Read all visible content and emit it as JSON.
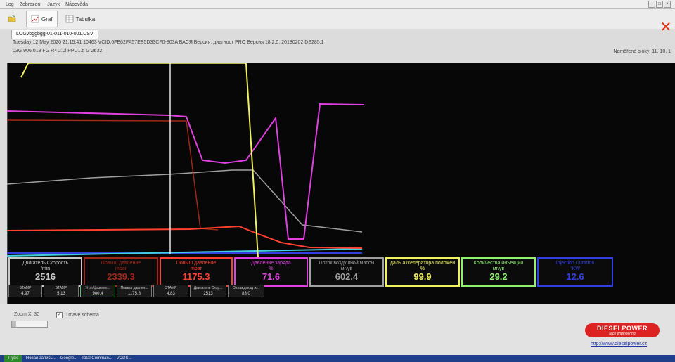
{
  "menu": {
    "items": [
      "Log",
      "Zobrazení",
      "Jazyk",
      "Nápověda"
    ]
  },
  "toolbar": {
    "graf_label": "Graf",
    "tabulka_label": "Tabulka"
  },
  "file_tab": {
    "name": "LOGvbggbgg-01-011-010-001.CSV"
  },
  "info": {
    "line1": "Tuesday 12 May 2020 21:15:41 10463 VCID:6FE62FA57EB5D33CF0-803A ВАСЯ Версия: диагност PRO Версия 18.2.0: 20180202 DS285.1",
    "line2": "03G 906 018 FG  R4 2.0l PPD1.5 G    2632",
    "blocks": "Naměřené bloky: 11, 10, 1"
  },
  "colors": {
    "pink": "#e040e0",
    "darkred": "#a02818",
    "gray": "#a0a0a0",
    "red": "#ff4030",
    "yellow": "#f0f060",
    "white": "#e8e8e8",
    "cyan": "#40d0e0",
    "blue": "#3040e0",
    "green": "#90f070"
  },
  "panels": [
    {
      "label": "Двигатель Скорость",
      "unit": "/min",
      "value": "2516",
      "color": "#c8c8c8"
    },
    {
      "label": "Повыш давление",
      "unit": "mbar",
      "value": "2339.3",
      "color": "#a02818"
    },
    {
      "label": "Повыш давление",
      "unit": "mbar",
      "value": "1175.3",
      "color": "#ff4030"
    },
    {
      "label": "Давление заряда",
      "unit": "%",
      "value": "71.6",
      "color": "#e040e0"
    },
    {
      "label": "Поток воздушной массы",
      "unit": "мг/ув",
      "value": "602.4",
      "color": "#a0a0a0"
    },
    {
      "label": "даль акселератора.положен",
      "unit": "%",
      "value": "99.9",
      "color": "#f0f060"
    },
    {
      "label": "Количества инъекции",
      "unit": "мг/ув",
      "value": "29.2",
      "color": "#90f070"
    },
    {
      "label": "Injection Duration",
      "unit": "°KW",
      "value": "12.6",
      "color": "#3040e0"
    }
  ],
  "mini_panels": [
    {
      "label": "STAMP",
      "value": "4.97"
    },
    {
      "label": "STAMP",
      "value": "5.13"
    },
    {
      "label": "Угол/фазы вп...",
      "value": "900.4"
    },
    {
      "label": "Повыш давлен...",
      "value": "1175.8"
    },
    {
      "label": "STAMP",
      "value": "4.83"
    },
    {
      "label": "Двигатель Скор...",
      "value": "2513"
    },
    {
      "label": "Охлаждающ ж...",
      "value": "83.0"
    }
  ],
  "bottom": {
    "zoom_label": "Zoom X: 30",
    "checkbox_label": "Tmavé schéma",
    "logo_text": "DIESELPOWER",
    "logo_sub": "race engineering",
    "url": "http://www.dieselpower.cz"
  },
  "taskbar": {
    "start_label": "Пуск",
    "items": [
      "Новая запись...",
      "Google...",
      "Total Comman...",
      "VCDS..."
    ]
  }
}
